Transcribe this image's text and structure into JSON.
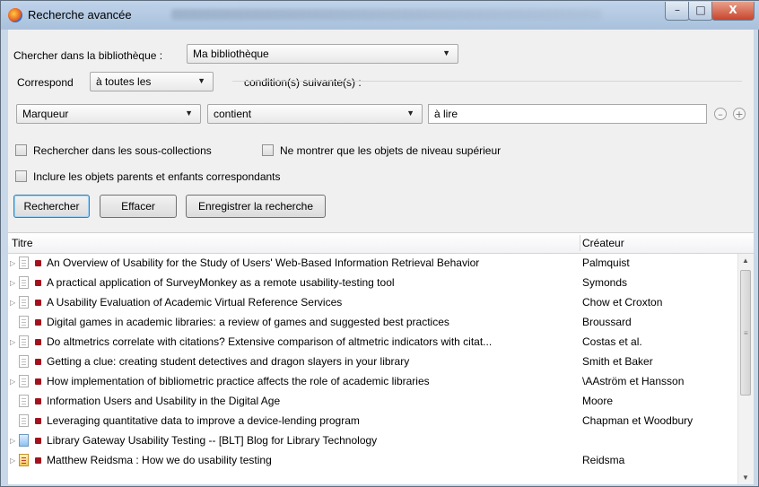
{
  "window": {
    "title": "Recherche avancée",
    "controls": [
      "–",
      "□",
      "X"
    ]
  },
  "search": {
    "library_label": "Chercher dans la bibliothèque :",
    "library_value": "Ma bibliothèque",
    "match_label": "Correspond",
    "match_value": "à toutes les",
    "conditions_label": "condition(s) suivante(s) :",
    "condition": {
      "field": "Marqueur",
      "operator": "contient",
      "value": "à lire"
    },
    "remove_symbol": "–",
    "add_symbol": "+",
    "checkbox_subcollections": "Rechercher dans les sous-collections",
    "checkbox_top_level": "Ne montrer que les objets de niveau supérieur",
    "checkbox_parents": "Inclure les objets parents et enfants correspondants",
    "buttons": {
      "search": "Rechercher",
      "clear": "Effacer",
      "save": "Enregistrer la recherche"
    }
  },
  "results": {
    "columns": {
      "title": "Titre",
      "creator": "Créateur"
    },
    "rows": [
      {
        "title": "An Overview of Usability for the Study of Users' Web-Based Information Retrieval Behavior",
        "creator": "Palmquist",
        "expandable": true,
        "type": "doc"
      },
      {
        "title": "A practical application of SurveyMonkey as a remote usability-testing tool",
        "creator": "Symonds",
        "expandable": true,
        "type": "doc"
      },
      {
        "title": "A Usability Evaluation of Academic Virtual Reference Services",
        "creator": "Chow et Croxton",
        "expandable": true,
        "type": "doc"
      },
      {
        "title": "Digital games in academic libraries: a review of games and suggested best practices",
        "creator": "Broussard",
        "expandable": false,
        "type": "doc"
      },
      {
        "title": "Do altmetrics correlate with citations? Extensive comparison of altmetric indicators with citat...",
        "creator": "Costas et al.",
        "expandable": true,
        "type": "doc"
      },
      {
        "title": "Getting a clue: creating student detectives and dragon slayers in your library",
        "creator": "Smith et Baker",
        "expandable": false,
        "type": "doc"
      },
      {
        "title": "How implementation of bibliometric practice affects the role of academic libraries",
        "creator": "\\AAström et Hansson",
        "expandable": true,
        "type": "doc"
      },
      {
        "title": "Information Users and Usability in the Digital Age",
        "creator": "Moore",
        "expandable": false,
        "type": "doc"
      },
      {
        "title": "Leveraging quantitative data to improve a device-lending program",
        "creator": "Chapman et Woodbury",
        "expandable": false,
        "type": "doc"
      },
      {
        "title": "Library Gateway Usability Testing -- [BLT] Blog for Library Technology",
        "creator": "",
        "expandable": true,
        "type": "web"
      },
      {
        "title": "Matthew Reidsma : How we do usability testing",
        "creator": "Reidsma",
        "expandable": true,
        "type": "post"
      }
    ]
  },
  "colors": {
    "tag": "#a3131e",
    "titlebar": "#b4cae3"
  }
}
